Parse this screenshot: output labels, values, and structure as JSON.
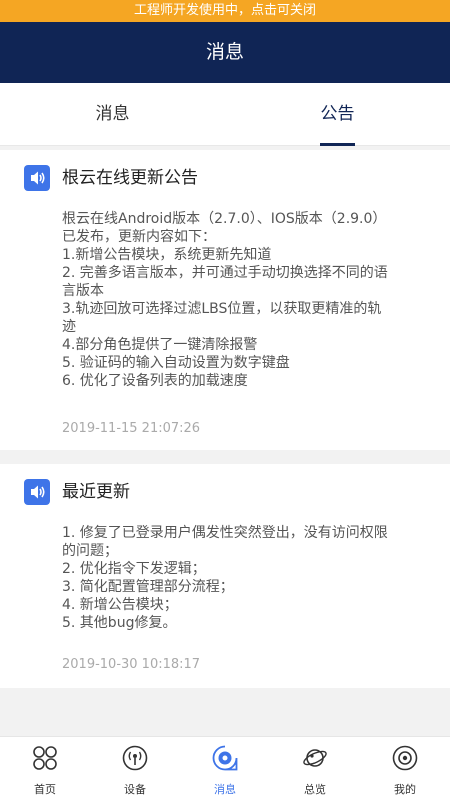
{
  "dev_banner": "工程师开发使用中，点击可关闭",
  "nav_title": "消息",
  "tabs": [
    {
      "label": "消息",
      "active": false
    },
    {
      "label": "公告",
      "active": true
    }
  ],
  "notices": [
    {
      "icon": "speaker-icon",
      "title": "根云在线更新公告",
      "body": [
        "根云在线Android版本（2.7.0）、IOS版本（2.9.0）",
        "已发布，更新内容如下：",
        "1.新增公告模块，系统更新先知道",
        "2. 完善多语言版本，并可通过手动切换选择不同的语",
        "言版本",
        "3.轨迹回放可选择过滤LBS位置，以获取更精准的轨",
        "迹",
        "4.部分角色提供了一键清除报警",
        "5. 验证码的输入自动设置为数字键盘",
        "6. 优化了设备列表的加载速度"
      ],
      "time": "2019-11-15 21:07:26"
    },
    {
      "icon": "speaker-icon",
      "title": "最近更新",
      "body": [
        "1. 修复了已登录用户偶发性突然登出，没有访问权限",
        "的问题；",
        "2. 优化指令下发逻辑；",
        "3. 简化配置管理部分流程；",
        "4. 新增公告模块；",
        "5. 其他bug修复。"
      ],
      "time": "2019-10-30 10:18:17"
    }
  ],
  "bottom_tabs": [
    {
      "label": "首页",
      "icon": "home-grid-icon",
      "active": false
    },
    {
      "label": "设备",
      "icon": "device-signal-icon",
      "active": false
    },
    {
      "label": "消息",
      "icon": "message-icon",
      "active": true
    },
    {
      "label": "总览",
      "icon": "planet-icon",
      "active": false
    },
    {
      "label": "我的",
      "icon": "profile-icon",
      "active": false
    }
  ],
  "colors": {
    "banner": "#f5a623",
    "nav": "#102555",
    "accent": "#3e74e8"
  }
}
